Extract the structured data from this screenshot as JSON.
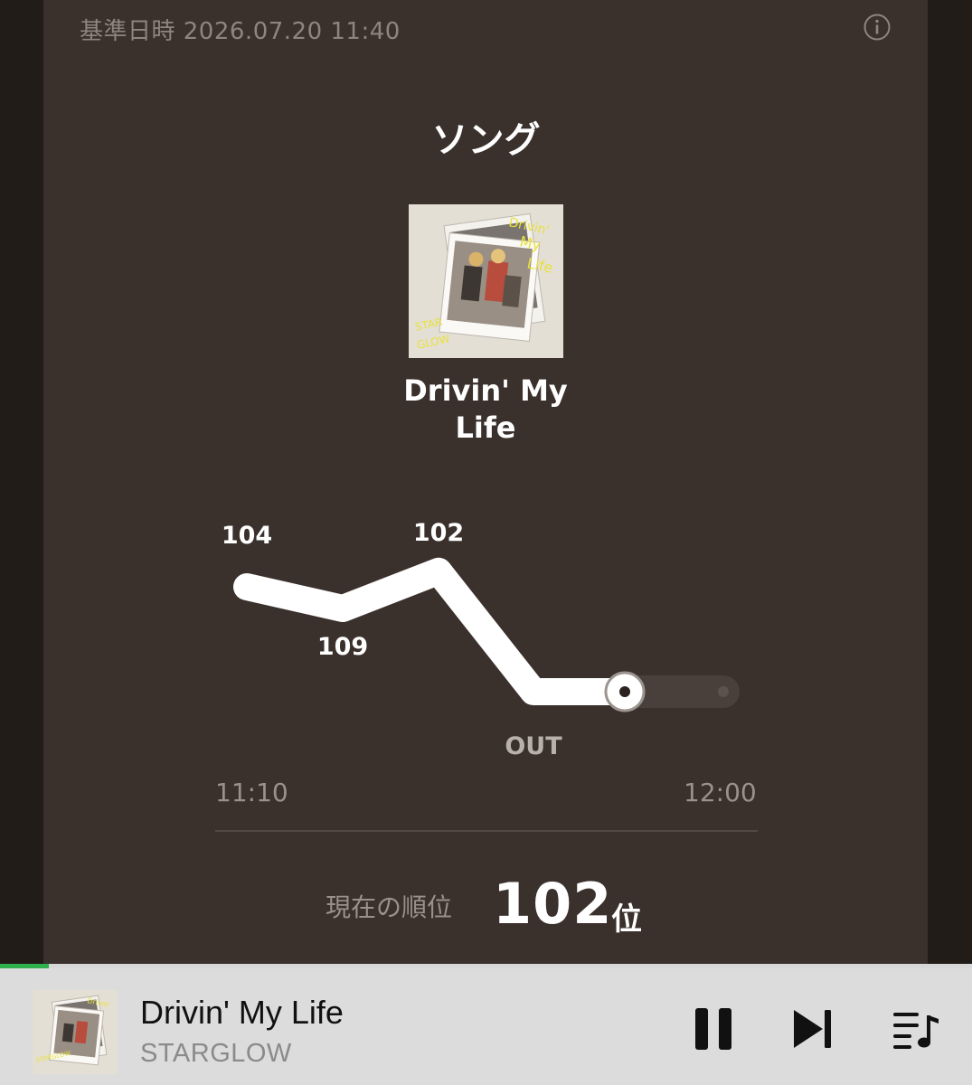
{
  "header": {
    "reference_time": "基準日時 2026.07.20 11:40",
    "info_icon": "info-icon"
  },
  "section": {
    "title": "ソング"
  },
  "song": {
    "title_line1": "Drivin' My",
    "title_line2": "Life"
  },
  "chart_data": {
    "type": "line",
    "x_start_label": "11:10",
    "x_end_label": "12:00",
    "points": [
      {
        "label": "104",
        "rank": 104
      },
      {
        "label": "109",
        "rank": 109
      },
      {
        "label": "102",
        "rank": 102
      },
      {
        "label": "OUT",
        "rank": null
      },
      {
        "label": "",
        "rank": null
      }
    ],
    "current_index": 4,
    "colors": {
      "line": "#ffffff",
      "future": "#4a403b",
      "label_out": "#b8b0aa"
    }
  },
  "rank": {
    "label": "現在の順位",
    "value": "102",
    "unit": "位"
  },
  "player": {
    "title": "Drivin' My Life",
    "artist": "STARGLOW",
    "progress": 0.05,
    "pause_icon": "pause-icon",
    "next_icon": "skip-next-icon",
    "queue_icon": "queue-music-icon"
  }
}
